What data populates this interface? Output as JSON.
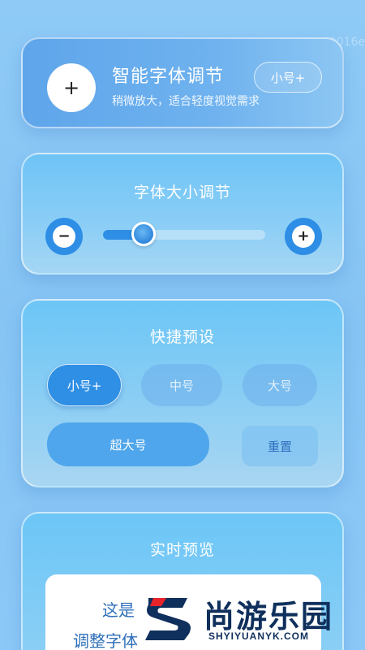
{
  "watermark_top": "99016e",
  "smart_font": {
    "add_symbol": "+",
    "title": "智能字体调节",
    "subtitle": "稍微放大，适合轻度视觉需求",
    "current_size": "小号+"
  },
  "size_adjust": {
    "title": "字体大小调节",
    "minus_symbol": "−",
    "plus_symbol": "+",
    "slider_fraction": 0.25
  },
  "presets": {
    "title": "快捷预设",
    "small_plus": "小号+",
    "medium": "中号",
    "large": "大号",
    "extra_large": "超大号",
    "reset": "重置"
  },
  "preview": {
    "title": "实时预览",
    "line1": "这是",
    "line2": "调整字体"
  },
  "logo": {
    "text": "尚游乐园",
    "url": "SHYIYUANYK.COM"
  },
  "colors": {
    "accent": "#2e8ee6",
    "background": "#8cc8f6",
    "logo_red": "#e8232a",
    "logo_navy": "#0f2f5c"
  }
}
